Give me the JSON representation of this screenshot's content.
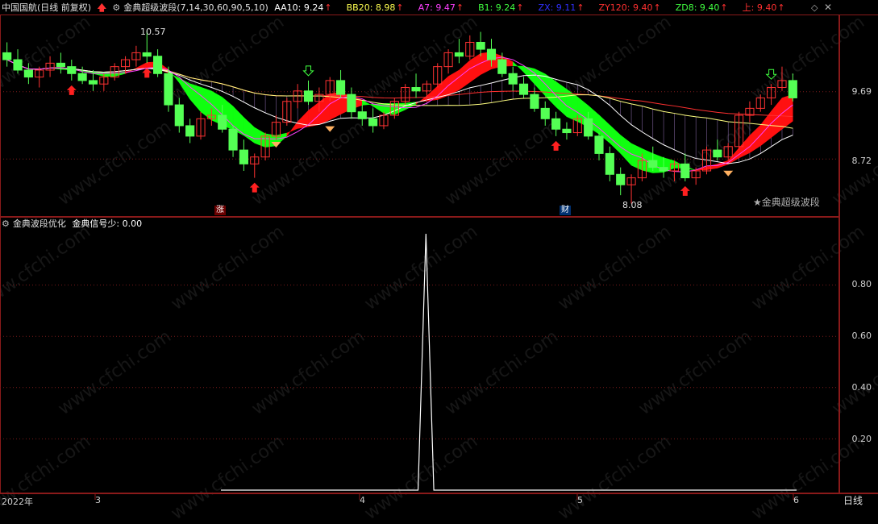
{
  "header1": {
    "security": "中国国航",
    "mode": "(日线 前复权)",
    "indicator": "金典超级波段",
    "params": "(7,14,30,60,90,5,10)",
    "items": [
      {
        "label": "AA10: 9.24",
        "color": "#ffffff"
      },
      {
        "label": "BB20: 8.98",
        "color": "#ffff50"
      },
      {
        "label": "A7: 9.47",
        "color": "#ff40ff"
      },
      {
        "label": "B1: 9.24",
        "color": "#40ff40"
      },
      {
        "label": "ZX: 9.11",
        "color": "#3030ff"
      },
      {
        "label": "ZY120: 9.40",
        "color": "#ff3030"
      },
      {
        "label": "ZD8: 9.40",
        "color": "#40ff40"
      },
      {
        "label": "上: 9.40",
        "color": "#ff3030"
      }
    ]
  },
  "header2": {
    "indicator": "金典波段优化",
    "value": "金典信号少: 0.00"
  },
  "main_chart": {
    "y_ticks": [
      "9.69",
      "8.72"
    ],
    "high_annot": "10.57",
    "low_annot": "8.08",
    "tag_zhang": "涨",
    "tag_cai": "财",
    "brand": "★金典超级波段"
  },
  "sub_chart": {
    "y_ticks": [
      "0.80",
      "0.60",
      "0.40",
      "0.20"
    ]
  },
  "x_axis": {
    "labels": [
      "2022年",
      "3",
      "4",
      "5",
      "6"
    ],
    "period": "日线"
  },
  "watermark": "www.cfchi.com",
  "chart_data": [
    {
      "type": "candlestick",
      "title": "金典超级波段",
      "y_ticks": [
        9.69,
        8.72
      ],
      "ylim": [
        7.9,
        10.8
      ],
      "annotations": [
        {
          "text": "10.57",
          "value": 10.57
        },
        {
          "text": "8.08",
          "value": 8.08
        }
      ],
      "candles": [
        [
          10.25,
          10.4,
          10.05,
          10.15
        ],
        [
          10.15,
          10.3,
          9.95,
          10.0
        ],
        [
          10.0,
          10.1,
          9.8,
          9.9
        ],
        [
          9.9,
          10.05,
          9.75,
          10.0
        ],
        [
          10.0,
          10.2,
          9.9,
          10.1
        ],
        [
          10.1,
          10.25,
          9.95,
          10.05
        ],
        [
          10.05,
          10.15,
          9.85,
          9.95
        ],
        [
          9.95,
          10.05,
          9.8,
          9.85
        ],
        [
          9.85,
          10.0,
          9.7,
          9.8
        ],
        [
          9.8,
          9.95,
          9.7,
          9.9
        ],
        [
          9.9,
          10.1,
          9.85,
          10.05
        ],
        [
          10.05,
          10.2,
          9.95,
          10.15
        ],
        [
          10.15,
          10.35,
          10.05,
          10.25
        ],
        [
          10.25,
          10.57,
          10.1,
          10.2
        ],
        [
          10.2,
          10.3,
          9.9,
          9.95
        ],
        [
          9.95,
          10.05,
          9.4,
          9.5
        ],
        [
          9.5,
          9.6,
          9.1,
          9.2
        ],
        [
          9.2,
          9.3,
          8.95,
          9.05
        ],
        [
          9.05,
          9.4,
          9.0,
          9.3
        ],
        [
          9.3,
          9.45,
          9.2,
          9.35
        ],
        [
          9.35,
          9.5,
          9.1,
          9.15
        ],
        [
          9.15,
          9.2,
          8.75,
          8.85
        ],
        [
          8.85,
          9.0,
          8.55,
          8.65
        ],
        [
          8.65,
          8.8,
          8.45,
          8.75
        ],
        [
          8.75,
          9.1,
          8.7,
          9.05
        ],
        [
          9.05,
          9.35,
          9.0,
          9.25
        ],
        [
          9.25,
          9.6,
          9.2,
          9.55
        ],
        [
          9.55,
          9.8,
          9.45,
          9.7
        ],
        [
          9.7,
          9.85,
          9.5,
          9.55
        ],
        [
          9.55,
          9.75,
          9.4,
          9.65
        ],
        [
          9.65,
          9.9,
          9.55,
          9.85
        ],
        [
          9.85,
          10.0,
          9.6,
          9.65
        ],
        [
          9.65,
          9.75,
          9.3,
          9.4
        ],
        [
          9.4,
          9.5,
          9.2,
          9.3
        ],
        [
          9.3,
          9.45,
          9.1,
          9.2
        ],
        [
          9.2,
          9.4,
          9.15,
          9.35
        ],
        [
          9.35,
          9.6,
          9.3,
          9.55
        ],
        [
          9.55,
          9.8,
          9.5,
          9.75
        ],
        [
          9.75,
          9.95,
          9.6,
          9.7
        ],
        [
          9.7,
          9.85,
          9.55,
          9.8
        ],
        [
          9.8,
          10.1,
          9.75,
          10.05
        ],
        [
          10.05,
          10.3,
          9.95,
          10.25
        ],
        [
          10.25,
          10.45,
          10.1,
          10.2
        ],
        [
          10.2,
          10.5,
          10.15,
          10.4
        ],
        [
          10.4,
          10.55,
          10.2,
          10.3
        ],
        [
          10.3,
          10.45,
          10.05,
          10.15
        ],
        [
          10.15,
          10.25,
          9.9,
          9.95
        ],
        [
          9.95,
          10.05,
          9.7,
          9.8
        ],
        [
          9.8,
          9.9,
          9.6,
          9.65
        ],
        [
          9.65,
          9.75,
          9.4,
          9.45
        ],
        [
          9.45,
          9.55,
          9.2,
          9.3
        ],
        [
          9.3,
          9.4,
          9.05,
          9.15
        ],
        [
          9.15,
          9.25,
          9.0,
          9.1
        ],
        [
          9.1,
          9.35,
          9.05,
          9.3
        ],
        [
          9.3,
          9.4,
          9.0,
          9.05
        ],
        [
          9.05,
          9.1,
          8.7,
          8.8
        ],
        [
          8.8,
          8.9,
          8.4,
          8.5
        ],
        [
          8.5,
          8.6,
          8.2,
          8.35
        ],
        [
          8.35,
          8.5,
          8.08,
          8.45
        ],
        [
          8.45,
          8.8,
          8.4,
          8.7
        ],
        [
          8.7,
          8.9,
          8.55,
          8.6
        ],
        [
          8.6,
          8.75,
          8.45,
          8.55
        ],
        [
          8.55,
          8.7,
          8.4,
          8.65
        ],
        [
          8.65,
          8.8,
          8.4,
          8.45
        ],
        [
          8.45,
          8.6,
          8.35,
          8.55
        ],
        [
          8.55,
          8.9,
          8.5,
          8.85
        ],
        [
          8.85,
          9.0,
          8.7,
          8.75
        ],
        [
          8.75,
          8.95,
          8.7,
          8.9
        ],
        [
          8.9,
          9.4,
          8.85,
          9.35
        ],
        [
          9.35,
          9.55,
          9.25,
          9.45
        ],
        [
          9.45,
          9.65,
          9.4,
          9.6
        ],
        [
          9.6,
          9.8,
          9.5,
          9.75
        ],
        [
          9.75,
          10.05,
          9.7,
          9.85
        ],
        [
          9.85,
          9.95,
          9.55,
          9.6
        ]
      ]
    },
    {
      "type": "line",
      "title": "金典波段优化",
      "series": [
        {
          "name": "金典信号少",
          "values": [
            0,
            0,
            0,
            0,
            0,
            0,
            0,
            0,
            0,
            0,
            0,
            0,
            0,
            0,
            0,
            0,
            0,
            0,
            0,
            0,
            0,
            0,
            0,
            0,
            0,
            0,
            1,
            0,
            0,
            0,
            0,
            0,
            0,
            0,
            0,
            0,
            0,
            0,
            0,
            0,
            0,
            0,
            0,
            0,
            0,
            0,
            0,
            0,
            0,
            0,
            0,
            0,
            0,
            0,
            0,
            0,
            0,
            0,
            0,
            0,
            0,
            0,
            0,
            0,
            0,
            0,
            0,
            0,
            0,
            0,
            0,
            0,
            0,
            0
          ]
        }
      ],
      "ylim": [
        0,
        1
      ],
      "y_ticks": [
        0.8,
        0.6,
        0.4,
        0.2
      ]
    }
  ]
}
